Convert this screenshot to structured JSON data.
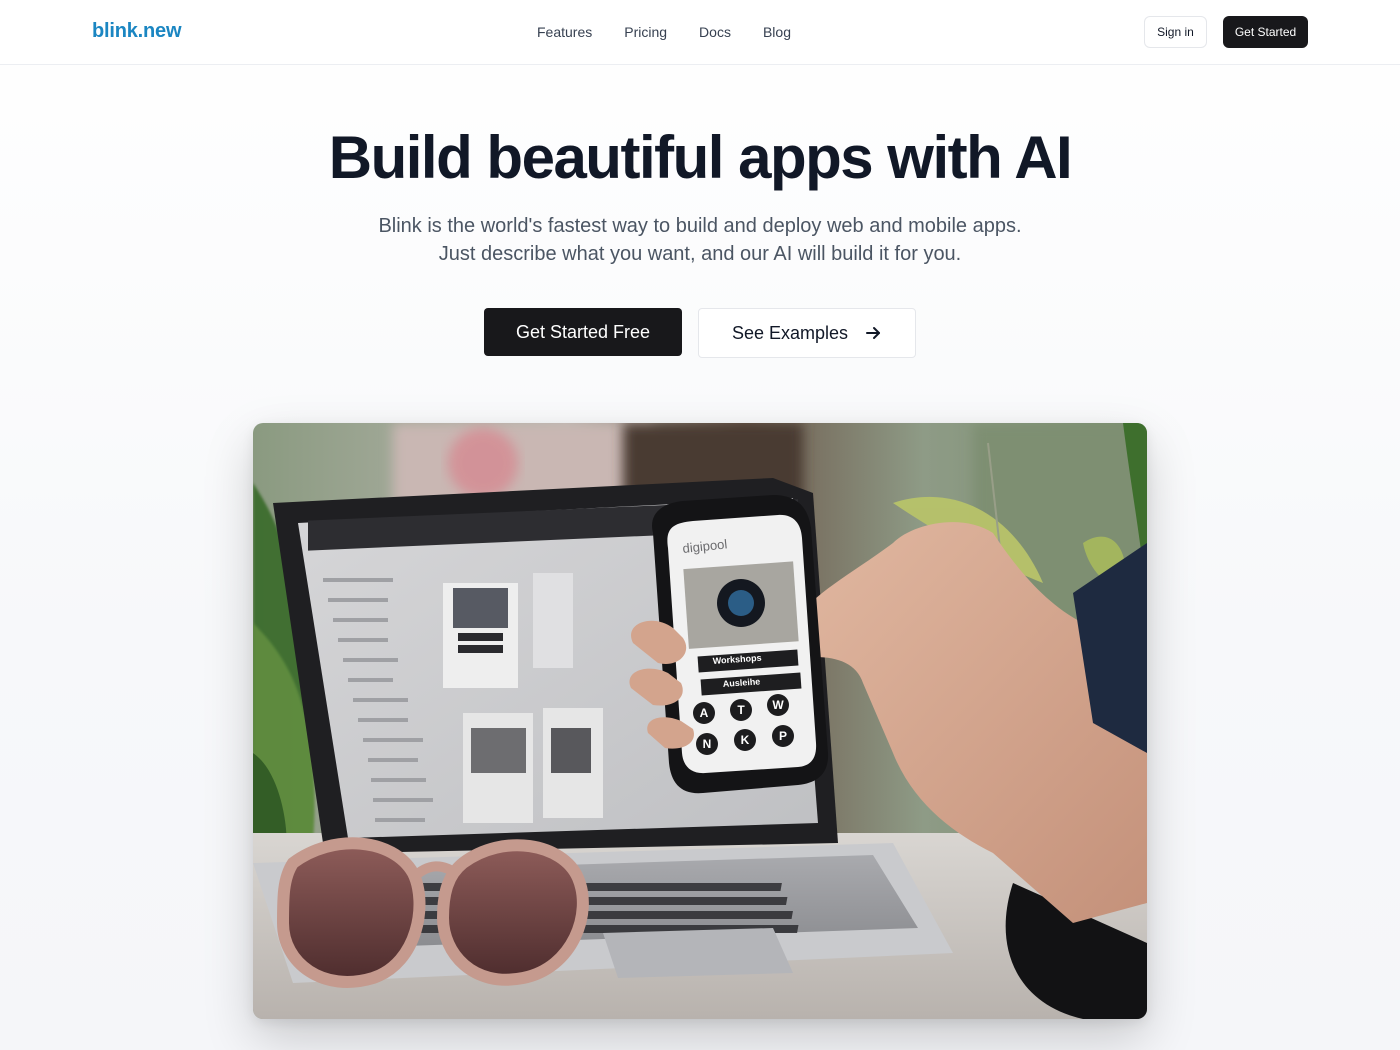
{
  "header": {
    "logo": "blink.new",
    "nav": [
      "Features",
      "Pricing",
      "Docs",
      "Blog"
    ],
    "sign_in": "Sign in",
    "get_started": "Get Started"
  },
  "hero": {
    "title": "Build beautiful apps with AI",
    "subtitle_line1": "Blink is the world's fastest way to build and deploy web and mobile apps.",
    "subtitle_line2": "Just describe what you want, and our AI will build it for you.",
    "cta_primary": "Get Started Free",
    "cta_secondary": "See Examples",
    "cta_secondary_icon": "arrow-right-icon"
  },
  "hero_image": {
    "phone_app_name": "digipool",
    "phone_buttons": [
      "Workshops",
      "Ausleihe"
    ],
    "phone_icons": [
      "A",
      "T",
      "W",
      "N",
      "K",
      "P"
    ]
  },
  "colors": {
    "brand": "#1b86c2",
    "dark": "#18181b",
    "text": "#111827",
    "muted": "#4b5563"
  }
}
